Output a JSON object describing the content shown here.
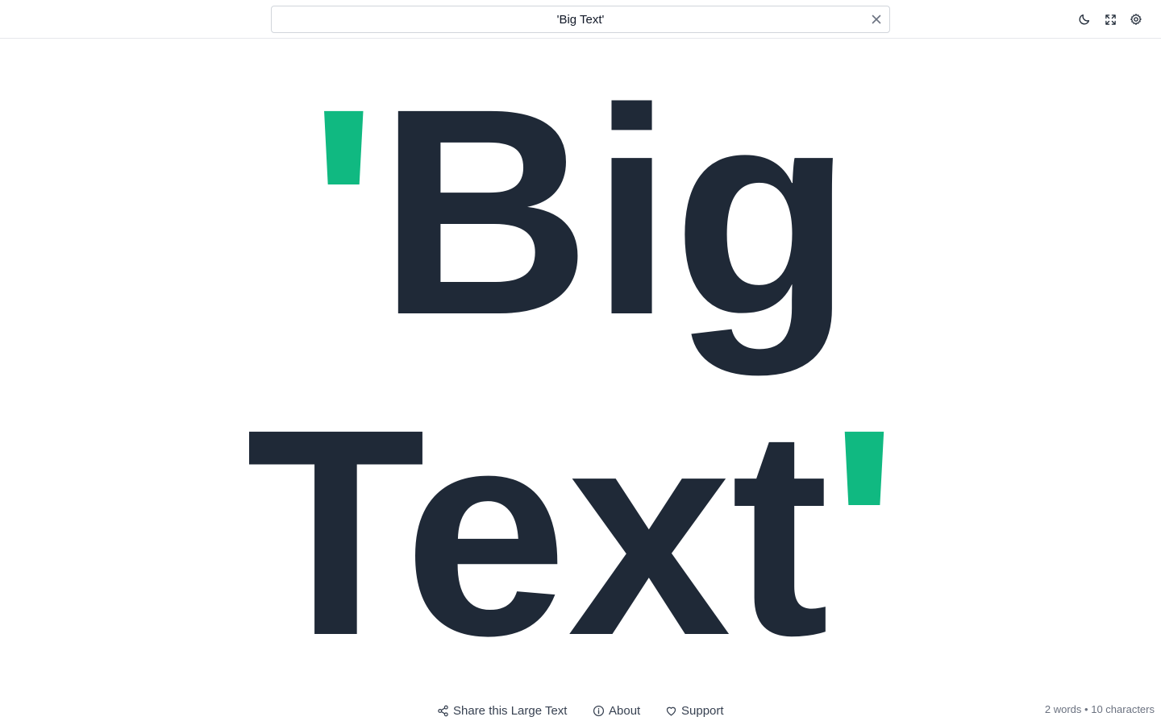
{
  "search": {
    "value": "'Big Text'"
  },
  "toolbar": {
    "dark_mode_icon": "moon-icon",
    "fullscreen_icon": "expand-icon",
    "settings_icon": "gear-icon"
  },
  "display": {
    "line1": {
      "quote": "'",
      "word": "Big"
    },
    "line2": {
      "word": "Text",
      "quote": "'"
    },
    "quote_color": "#10b981",
    "text_color": "#1f2937"
  },
  "footer": {
    "share_label": "Share this Large Text",
    "about_label": "About",
    "support_label": "Support"
  },
  "stats": {
    "words": "2 words",
    "separator": "•",
    "characters": "10 characters"
  }
}
